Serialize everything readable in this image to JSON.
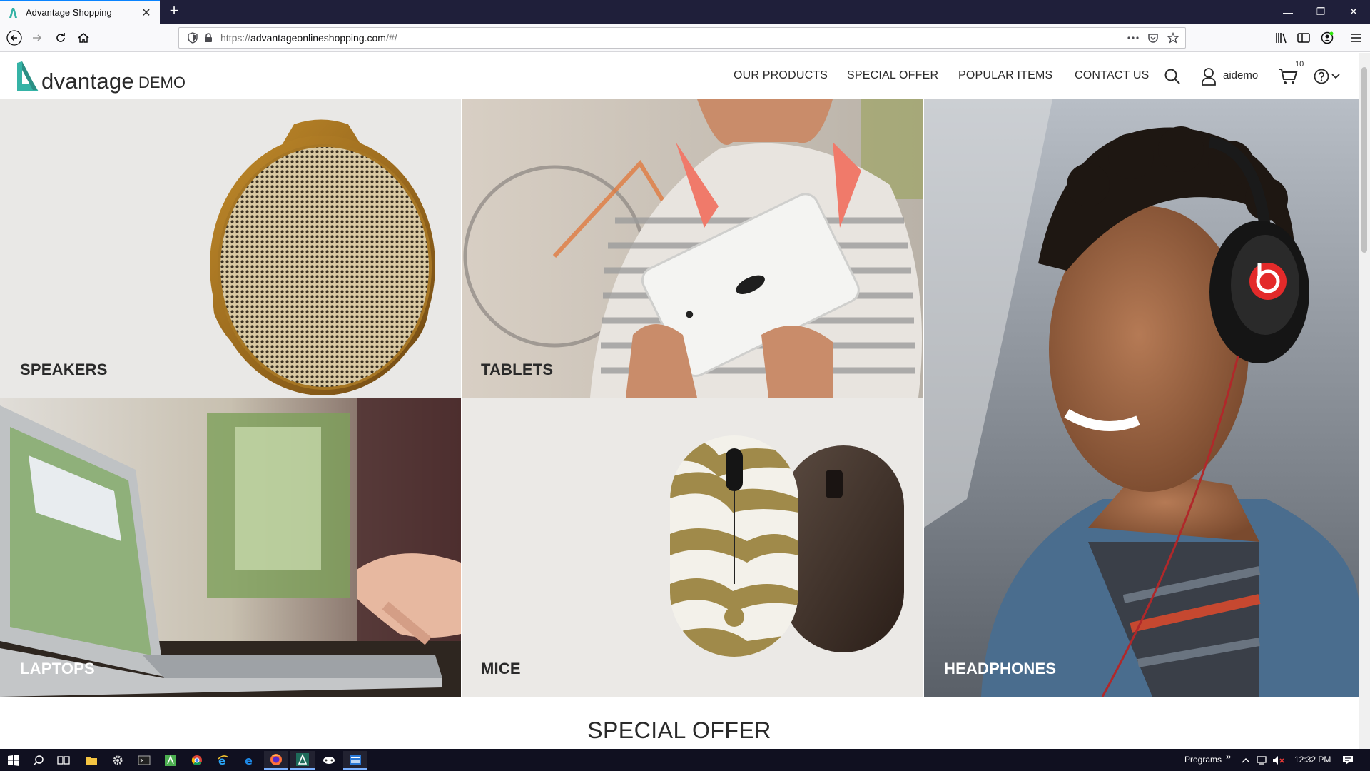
{
  "browser": {
    "tab_title": "Advantage Shopping",
    "url_prefix": "https://",
    "url_host": "advantageonlineshopping.com",
    "url_path": "/#/"
  },
  "site": {
    "logo_word": "dvantage",
    "logo_demo": "DEMO",
    "menu": {
      "our_products": "OUR PRODUCTS",
      "special_offer": "SPECIAL OFFER",
      "popular_items": "POPULAR ITEMS",
      "contact_us": "CONTACT US"
    },
    "user_name": "aidemo",
    "cart_count": "10",
    "accent_color": "#35b3a6"
  },
  "categories": {
    "speakers": "SPEAKERS",
    "tablets": "TABLETS",
    "headphones": "HEADPHONES",
    "laptops": "LAPTOPS",
    "mice": "MICE"
  },
  "section_title": "SPECIAL OFFER",
  "taskbar": {
    "programs_label": "Programs",
    "overflow": "»",
    "clock": "12:32 PM"
  }
}
